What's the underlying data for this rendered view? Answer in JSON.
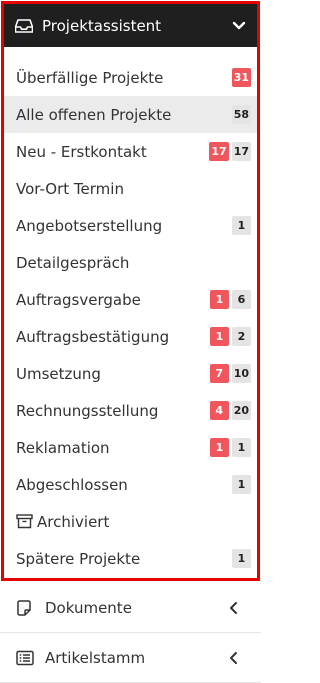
{
  "header": {
    "title": "Projektassistent",
    "icon": "inbox-icon",
    "toggle_icon": "chevron-down-icon"
  },
  "items": [
    {
      "label": "Überfällige Projekte",
      "red": "31",
      "gray": null
    },
    {
      "label": "Alle offenen Projekte",
      "red": null,
      "gray": "58",
      "active": true
    },
    {
      "label": "Neu - Erstkontakt",
      "red": "17",
      "gray": "17"
    },
    {
      "label": "Vor-Ort Termin",
      "red": null,
      "gray": null
    },
    {
      "label": "Angebotserstellung",
      "red": null,
      "gray": "1"
    },
    {
      "label": "Detailgespräch",
      "red": null,
      "gray": null
    },
    {
      "label": "Auftragsvergabe",
      "red": "1",
      "gray": "6"
    },
    {
      "label": "Auftragsbestätigung",
      "red": "1",
      "gray": "2"
    },
    {
      "label": "Umsetzung",
      "red": "7",
      "gray": "10"
    },
    {
      "label": "Rechnungsstellung",
      "red": "4",
      "gray": "20"
    },
    {
      "label": "Reklamation",
      "red": "1",
      "gray": "1"
    },
    {
      "label": "Abgeschlossen",
      "red": null,
      "gray": "1"
    },
    {
      "label": "Archiviert",
      "red": null,
      "gray": null,
      "icon": "archive-icon"
    },
    {
      "label": "Spätere Projekte",
      "red": null,
      "gray": "1"
    }
  ],
  "footer": [
    {
      "label": "Dokumente",
      "icon": "document-icon"
    },
    {
      "label": "Artikelstamm",
      "icon": "list-icon"
    }
  ],
  "colors": {
    "header_bg": "#1f1f1f",
    "red_badge": "#f0575d",
    "gray_badge": "#e4e4e4",
    "highlight_border": "#e60000",
    "active_row": "#ebebeb"
  }
}
